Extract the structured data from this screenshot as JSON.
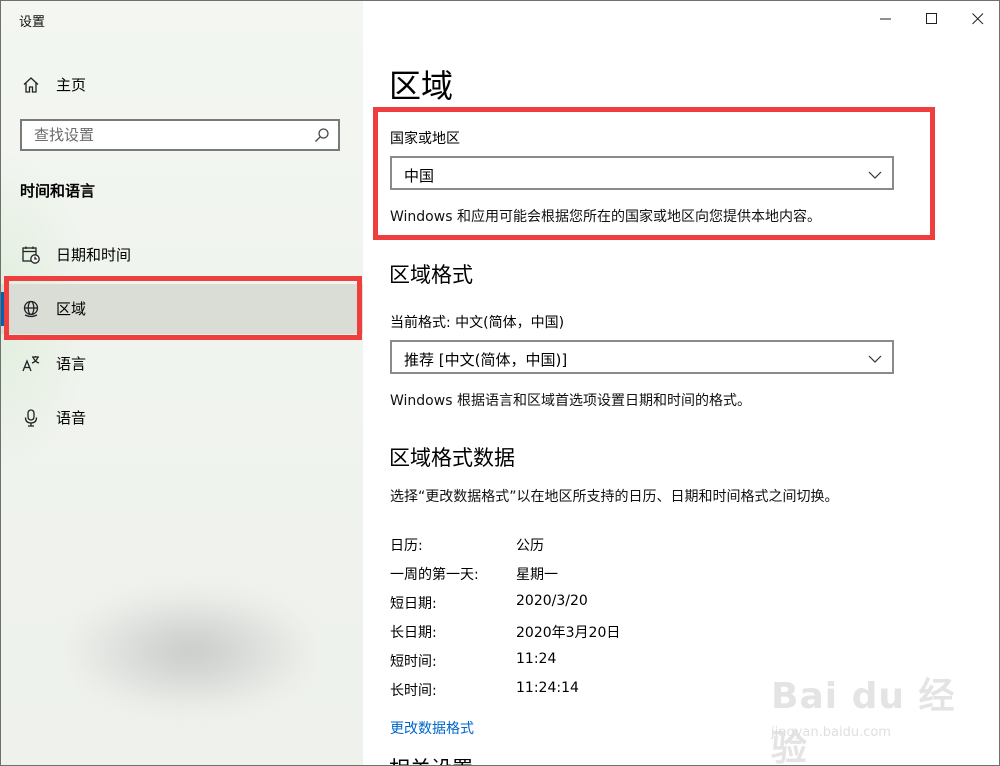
{
  "window": {
    "title": "设置"
  },
  "sidebar": {
    "home_label": "主页",
    "search_placeholder": "查找设置",
    "section_title": "时间和语言",
    "items": [
      {
        "label": "日期和时间",
        "icon": "calendar-clock-icon"
      },
      {
        "label": "区域",
        "icon": "globe-icon",
        "selected": true
      },
      {
        "label": "语言",
        "icon": "language-icon"
      },
      {
        "label": "语音",
        "icon": "microphone-icon"
      }
    ]
  },
  "main": {
    "title": "区域",
    "country": {
      "label": "国家或地区",
      "value": "中国",
      "description": "Windows 和应用可能会根据您所在的国家或地区向您提供本地内容。"
    },
    "format": {
      "heading": "区域格式",
      "label": "当前格式: 中文(简体，中国)",
      "value": "推荐 [中文(简体，中国)]",
      "description": "Windows 根据语言和区域首选项设置日期和时间的格式。"
    },
    "format_data": {
      "heading": "区域格式数据",
      "description": "选择“更改数据格式”以在地区所支持的日历、日期和时间格式之间切换。",
      "rows": [
        {
          "key": "日历:",
          "value": "公历"
        },
        {
          "key": "一周的第一天:",
          "value": "星期一"
        },
        {
          "key": "短日期:",
          "value": "2020/3/20"
        },
        {
          "key": "长日期:",
          "value": "2020年3月20日"
        },
        {
          "key": "短时间:",
          "value": "11:24"
        },
        {
          "key": "长时间:",
          "value": "11:24:14"
        }
      ],
      "link": "更改数据格式"
    },
    "next_heading": "相关设置"
  },
  "watermark": {
    "text": "Bai du 经验",
    "sub": "jingyan.baidu.com"
  },
  "colors": {
    "accent": "#0063b1",
    "highlight": "#ee3e3e",
    "link": "#0066cc"
  }
}
